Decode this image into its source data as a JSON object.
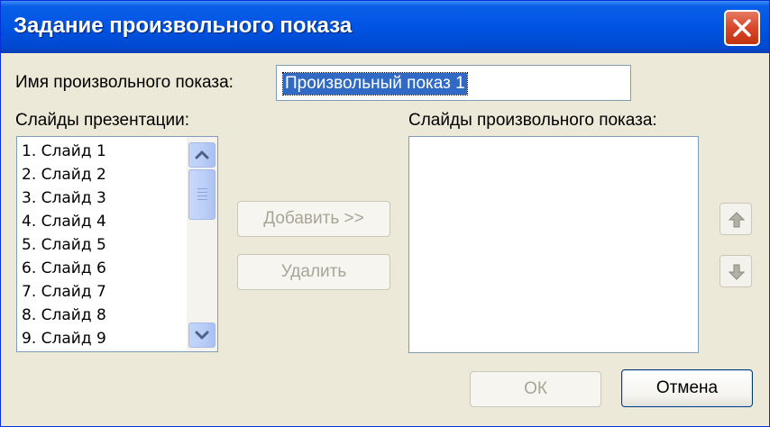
{
  "window": {
    "title": "Задание произвольного показа"
  },
  "name_field": {
    "label": "Имя произвольного показа:",
    "value": "Произвольный показ 1"
  },
  "presentation_slides": {
    "label": "Слайды презентации:",
    "items": [
      "1. Слайд 1",
      "2. Слайд 2",
      "3. Слайд 3",
      "4. Слайд 4",
      "5. Слайд 5",
      "6. Слайд 6",
      "7. Слайд 7",
      "8. Слайд 8",
      "9. Слайд 9"
    ]
  },
  "custom_show_slides": {
    "label": "Слайды произвольного показа:",
    "items": []
  },
  "buttons": {
    "add": "Добавить >>",
    "remove": "Удалить",
    "ok": "ОК",
    "cancel": "Отмена"
  },
  "icons": {
    "close": "close-icon",
    "scroll_up": "scroll-up-arrow-icon",
    "scroll_down": "scroll-down-arrow-icon",
    "scroll_grip": "scroll-grip-icon",
    "move_up": "move-up-arrow-icon",
    "move_down": "move-down-arrow-icon"
  },
  "colors": {
    "titlebar": "#0054e3",
    "dialog_bg": "#ece9d8",
    "close_button": "#d8472a",
    "selection": "#316ac5",
    "disabled_text": "#a7a696"
  }
}
